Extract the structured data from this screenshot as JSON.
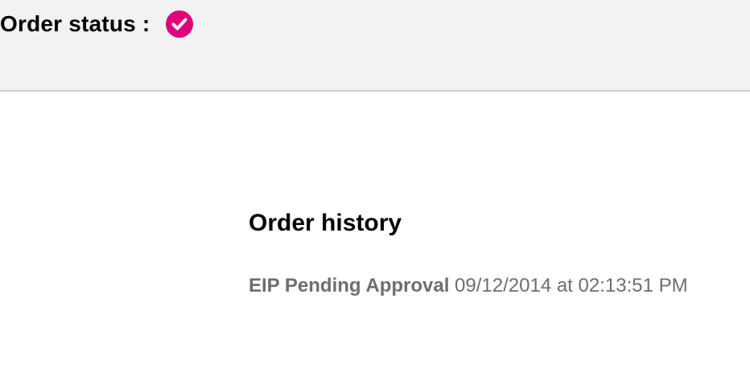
{
  "order_status": {
    "label": "Order status :",
    "icon": "check-circle-icon",
    "icon_color": "#e2007a"
  },
  "order_history": {
    "title": "Order history",
    "entries": [
      {
        "status": "EIP Pending Approval",
        "timestamp": "09/12/2014 at 02:13:51 PM"
      }
    ]
  }
}
